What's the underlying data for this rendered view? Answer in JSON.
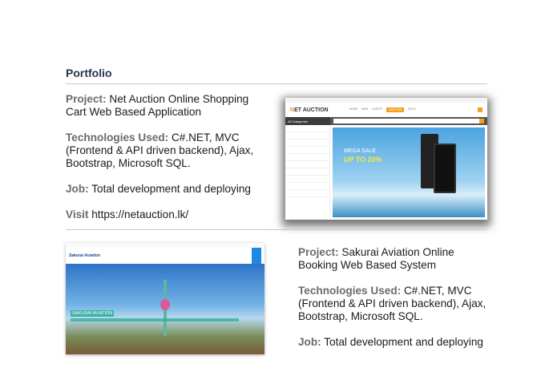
{
  "heading": "Portfolio",
  "projects": [
    {
      "project_label": "Project:",
      "project": "Net Auction Online Shopping Cart Web Based Application",
      "tech_label": "Technologies Used:",
      "tech": "C#.NET, MVC (Frontend & API driven backend), Ajax, Bootstrap, Microsoft SQL.",
      "job_label": "Job:",
      "job": "Total development and deploying",
      "visit_label": "Visit",
      "visit_url": "https://netauction.lk/",
      "screenshot": {
        "logo_a": "N",
        "logo_b": "ET AUCTION",
        "categories": "All Categories",
        "banner_line1": "MEGA SALE",
        "banner_line2": "UP TO 20%"
      }
    },
    {
      "project_label": "Project:",
      "project": "Sakurai Aviation Online Booking Web Based System",
      "tech_label": "Technologies Used:",
      "tech": "C#.NET, MVC (Frontend & API driven backend), Ajax, Bootstrap, Microsoft SQL.",
      "job_label": "Job:",
      "job": "Total development and deploying",
      "screenshot": {
        "brand": "Sakurai Aviation",
        "hero_title": "SAKURAI AVIATION"
      }
    }
  ]
}
